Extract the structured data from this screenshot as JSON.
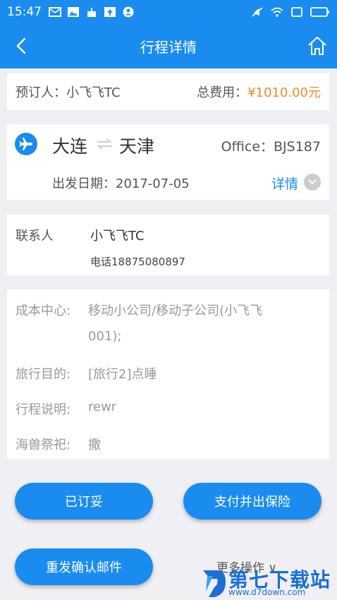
{
  "status_bar": {
    "time": "15:47"
  },
  "nav": {
    "title": "行程详情"
  },
  "booker": {
    "label": "预订人：小飞飞TC",
    "total_label": "总费用：",
    "total_value": "¥1010.00元"
  },
  "route": {
    "from": "大连",
    "to": "天津",
    "office": "Office：BJS187",
    "date": "出发日期：2017-07-05",
    "detail_label": "详情"
  },
  "contact": {
    "label": "联系人",
    "name": "小飞飞TC",
    "phone": "电话18875080897"
  },
  "info": {
    "cost_center_label": "成本中心:",
    "cost_center_line1": "移动小公司/移动子公司(小飞飞",
    "cost_center_line2": "001);",
    "trip_purpose_label": "旅行目的:",
    "trip_purpose_value": "[旅行2]点睡",
    "trip_desc_label": "行程说明:",
    "trip_desc_value": "rewr",
    "sea_label": "海兽祭祀:",
    "sea_value": "撒"
  },
  "buttons": {
    "booked": "已订妥",
    "pay_insure": "支付并出保险",
    "resend": "重发确认邮件",
    "more_ops": "更多操作 ∨"
  },
  "watermark": {
    "text": "第七下载站",
    "url": "www.d7down.com"
  },
  "colors": {
    "primary": "#1a8cf0",
    "price": "#f0892c"
  }
}
